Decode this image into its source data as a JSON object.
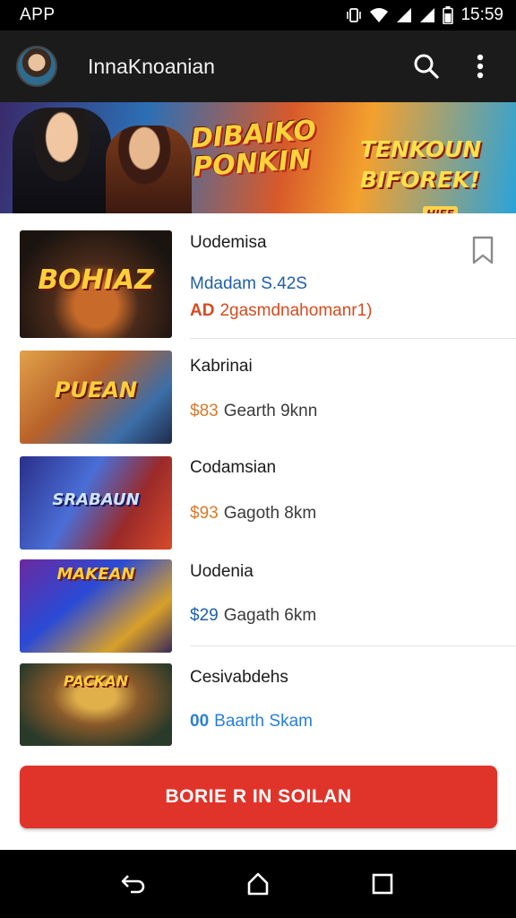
{
  "status_bar": {
    "app_label": "APP",
    "time": "15:59",
    "icons": [
      "vibrate-icon",
      "wifi-icon",
      "signal-icon",
      "signal-icon",
      "battery-icon"
    ]
  },
  "app_bar": {
    "title": "InnaKnoanian",
    "icons": [
      "avatar",
      "search-icon",
      "more-vert-icon"
    ]
  },
  "banner": {
    "title": "DIBAIKO PONKIN",
    "subtitle": "TENKOUN BIFOREK!",
    "tag": "HIEE"
  },
  "items": [
    {
      "title": "Uodemisa",
      "thumb_text": "BOHIAZ",
      "subtitle": "Mdadam S.42S",
      "subtitle_color": "#1f5fa8",
      "price": "AD",
      "price_note": "2gasmdnahomanr1)",
      "price_color": "#d64a1f",
      "bookmarked": false
    },
    {
      "title": "Kabrinai",
      "thumb_text": "PUEAN",
      "price": "$83",
      "price_note": "Gearth 9knn",
      "price_color": "#d87a2a"
    },
    {
      "title": "Codamsian",
      "thumb_text": "SRABAUN",
      "price": "$93",
      "price_note": "Gagoth 8km",
      "price_color": "#d87a2a"
    },
    {
      "title": "Uodenia",
      "thumb_text": "MAKEAN",
      "price": "$29",
      "price_note": "Gagath 6km",
      "price_color": "#1f5fa8"
    },
    {
      "title": "Cesivabdehs",
      "thumb_text": "PACKAN",
      "price": "00",
      "price_note": "Baarth Skam",
      "price_color": "#2a7fd6"
    }
  ],
  "cta_label": "BORIE R IN SOILAN",
  "nav_bar": {
    "icons": [
      "back-icon",
      "home-icon",
      "recents-icon"
    ]
  },
  "colors": {
    "accent": "#e0342a",
    "link": "#1f5fa8",
    "price_orange": "#d87a2a"
  }
}
